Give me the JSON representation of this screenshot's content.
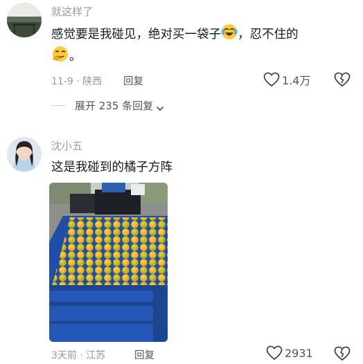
{
  "comment1": {
    "username": "就这样了",
    "text_part1": "感觉要是我碰见，绝对买一袋子",
    "text_part2": "，忍不住的",
    "text_part3": "。",
    "date_location": "11-9 · 陕西",
    "reply_label": "回复",
    "like_count": "1.4万",
    "emoji1": "laughing-crying-emoji",
    "emoji2": "drooling-emoji"
  },
  "expand": {
    "label": "展开 235 条回复"
  },
  "comment2": {
    "username": "沈小五",
    "text": "这是我碰到的橘子方阵",
    "date_location": "3天前 · 江苏",
    "reply_label": "回复",
    "like_count": "2931"
  },
  "icons": {
    "like": "heart-outline-icon",
    "dislike": "broken-heart-icon",
    "chevron": "chevron-down-icon"
  }
}
